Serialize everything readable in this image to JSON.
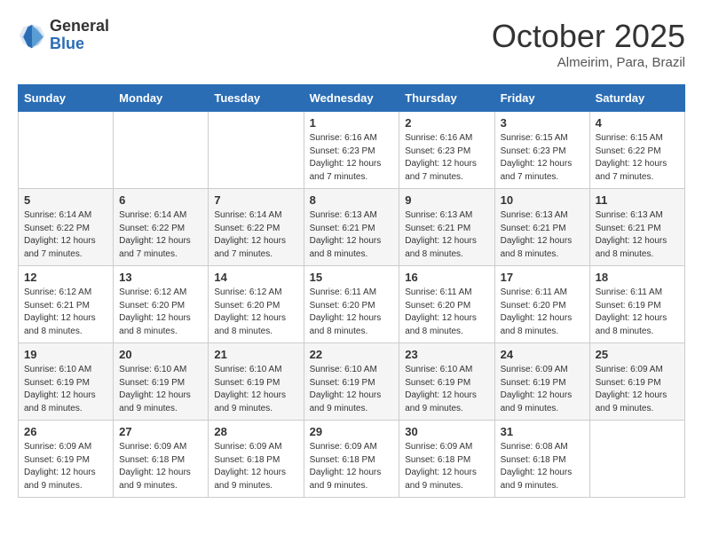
{
  "logo": {
    "general": "General",
    "blue": "Blue"
  },
  "title": "October 2025",
  "location": "Almeirim, Para, Brazil",
  "days_of_week": [
    "Sunday",
    "Monday",
    "Tuesday",
    "Wednesday",
    "Thursday",
    "Friday",
    "Saturday"
  ],
  "weeks": [
    [
      {
        "day": "",
        "info": ""
      },
      {
        "day": "",
        "info": ""
      },
      {
        "day": "",
        "info": ""
      },
      {
        "day": "1",
        "info": "Sunrise: 6:16 AM\nSunset: 6:23 PM\nDaylight: 12 hours and 7 minutes."
      },
      {
        "day": "2",
        "info": "Sunrise: 6:16 AM\nSunset: 6:23 PM\nDaylight: 12 hours and 7 minutes."
      },
      {
        "day": "3",
        "info": "Sunrise: 6:15 AM\nSunset: 6:23 PM\nDaylight: 12 hours and 7 minutes."
      },
      {
        "day": "4",
        "info": "Sunrise: 6:15 AM\nSunset: 6:22 PM\nDaylight: 12 hours and 7 minutes."
      }
    ],
    [
      {
        "day": "5",
        "info": "Sunrise: 6:14 AM\nSunset: 6:22 PM\nDaylight: 12 hours and 7 minutes."
      },
      {
        "day": "6",
        "info": "Sunrise: 6:14 AM\nSunset: 6:22 PM\nDaylight: 12 hours and 7 minutes."
      },
      {
        "day": "7",
        "info": "Sunrise: 6:14 AM\nSunset: 6:22 PM\nDaylight: 12 hours and 7 minutes."
      },
      {
        "day": "8",
        "info": "Sunrise: 6:13 AM\nSunset: 6:21 PM\nDaylight: 12 hours and 8 minutes."
      },
      {
        "day": "9",
        "info": "Sunrise: 6:13 AM\nSunset: 6:21 PM\nDaylight: 12 hours and 8 minutes."
      },
      {
        "day": "10",
        "info": "Sunrise: 6:13 AM\nSunset: 6:21 PM\nDaylight: 12 hours and 8 minutes."
      },
      {
        "day": "11",
        "info": "Sunrise: 6:13 AM\nSunset: 6:21 PM\nDaylight: 12 hours and 8 minutes."
      }
    ],
    [
      {
        "day": "12",
        "info": "Sunrise: 6:12 AM\nSunset: 6:21 PM\nDaylight: 12 hours and 8 minutes."
      },
      {
        "day": "13",
        "info": "Sunrise: 6:12 AM\nSunset: 6:20 PM\nDaylight: 12 hours and 8 minutes."
      },
      {
        "day": "14",
        "info": "Sunrise: 6:12 AM\nSunset: 6:20 PM\nDaylight: 12 hours and 8 minutes."
      },
      {
        "day": "15",
        "info": "Sunrise: 6:11 AM\nSunset: 6:20 PM\nDaylight: 12 hours and 8 minutes."
      },
      {
        "day": "16",
        "info": "Sunrise: 6:11 AM\nSunset: 6:20 PM\nDaylight: 12 hours and 8 minutes."
      },
      {
        "day": "17",
        "info": "Sunrise: 6:11 AM\nSunset: 6:20 PM\nDaylight: 12 hours and 8 minutes."
      },
      {
        "day": "18",
        "info": "Sunrise: 6:11 AM\nSunset: 6:19 PM\nDaylight: 12 hours and 8 minutes."
      }
    ],
    [
      {
        "day": "19",
        "info": "Sunrise: 6:10 AM\nSunset: 6:19 PM\nDaylight: 12 hours and 8 minutes."
      },
      {
        "day": "20",
        "info": "Sunrise: 6:10 AM\nSunset: 6:19 PM\nDaylight: 12 hours and 9 minutes."
      },
      {
        "day": "21",
        "info": "Sunrise: 6:10 AM\nSunset: 6:19 PM\nDaylight: 12 hours and 9 minutes."
      },
      {
        "day": "22",
        "info": "Sunrise: 6:10 AM\nSunset: 6:19 PM\nDaylight: 12 hours and 9 minutes."
      },
      {
        "day": "23",
        "info": "Sunrise: 6:10 AM\nSunset: 6:19 PM\nDaylight: 12 hours and 9 minutes."
      },
      {
        "day": "24",
        "info": "Sunrise: 6:09 AM\nSunset: 6:19 PM\nDaylight: 12 hours and 9 minutes."
      },
      {
        "day": "25",
        "info": "Sunrise: 6:09 AM\nSunset: 6:19 PM\nDaylight: 12 hours and 9 minutes."
      }
    ],
    [
      {
        "day": "26",
        "info": "Sunrise: 6:09 AM\nSunset: 6:19 PM\nDaylight: 12 hours and 9 minutes."
      },
      {
        "day": "27",
        "info": "Sunrise: 6:09 AM\nSunset: 6:18 PM\nDaylight: 12 hours and 9 minutes."
      },
      {
        "day": "28",
        "info": "Sunrise: 6:09 AM\nSunset: 6:18 PM\nDaylight: 12 hours and 9 minutes."
      },
      {
        "day": "29",
        "info": "Sunrise: 6:09 AM\nSunset: 6:18 PM\nDaylight: 12 hours and 9 minutes."
      },
      {
        "day": "30",
        "info": "Sunrise: 6:09 AM\nSunset: 6:18 PM\nDaylight: 12 hours and 9 minutes."
      },
      {
        "day": "31",
        "info": "Sunrise: 6:08 AM\nSunset: 6:18 PM\nDaylight: 12 hours and 9 minutes."
      },
      {
        "day": "",
        "info": ""
      }
    ]
  ]
}
